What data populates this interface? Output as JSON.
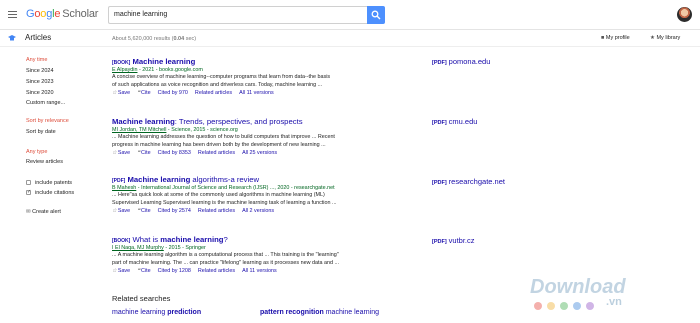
{
  "app": {
    "logo_google": "Google",
    "logo_scholar": "Scholar",
    "search_value": "machine learning",
    "section_title": "Articles",
    "results_count_prefix": "About 5,620,000 results (",
    "results_count_time": "0.04",
    "results_count_suffix": " sec)",
    "my_profile": "My profile",
    "my_library": "My library"
  },
  "sidebar": {
    "time": [
      "Any time",
      "Since 2024",
      "Since 2023",
      "Since 2020",
      "Custom range..."
    ],
    "sort": [
      "Sort by relevance",
      "Sort by date"
    ],
    "type": [
      "Any type",
      "Review articles"
    ],
    "checks": [
      "include patents",
      "include citations"
    ],
    "alert": "Create alert"
  },
  "results": [
    {
      "tag": "[BOOK]",
      "title_pre": "",
      "title_b": "Machine learning",
      "title_post": "",
      "author_link": "E Alpaydin",
      "author_rest": " - 2021 - books.google.com",
      "snip1": "A concise overview of machine learning--computer programs that learn from data--the basis",
      "snip2": "of such applications as voice recognition and driverless cars. Today, machine learning ...",
      "save": "Save",
      "cite": "Cite",
      "cited": "Cited by 970",
      "related": "Related articles",
      "versions": "All 11 versions",
      "pdf_tag": "[PDF]",
      "pdf_src": "pomona.edu"
    },
    {
      "tag": "",
      "title_pre": "",
      "title_b": "Machine learning",
      "title_post": ": Trends, perspectives, and prospects",
      "author_link": "MI Jordan, TM Mitchell",
      "author_rest": " - Science, 2015 - science.org",
      "snip1": "... Machine learning addresses the question of how to build computers that improve ... Recent",
      "snip2": "progress in machine learning has been driven both by the development of new learning ...",
      "save": "Save",
      "cite": "Cite",
      "cited": "Cited by 8353",
      "related": "Related articles",
      "versions": "All 25 versions",
      "pdf_tag": "[PDF]",
      "pdf_src": "cmu.edu"
    },
    {
      "tag": "[PDF]",
      "title_pre": "",
      "title_b": "Machine learning",
      "title_post": " algorithms-a review",
      "author_link": "B Mahesh",
      "author_rest": " - International Journal of Science and Research (IJSR) ..., 2020 - researchgate.net",
      "snip1": "... Here\"sa quick look at some of the commonly used algorithms in machine learning (ML)",
      "snip2": "Supervised Learning Supervised learning is the machine learning task of learning a function ...",
      "save": "Save",
      "cite": "Cite",
      "cited": "Cited by 2574",
      "related": "Related articles",
      "versions": "All 2 versions",
      "pdf_tag": "[PDF]",
      "pdf_src": "researchgate.net"
    },
    {
      "tag": "[BOOK]",
      "title_pre": "What is ",
      "title_b": "machine learning",
      "title_post": "?",
      "author_link": "I El Naqa, MJ Murphy",
      "author_rest": " - 2015 - Springer",
      "snip1": "... A machine learning algorithm is a computational process that ... This training is the \"learning\"",
      "snip2": "part of machine learning. The ... can practice \"lifelong\" learning as it processes new data and ...",
      "save": "Save",
      "cite": "Cite",
      "cited": "Cited by 1208",
      "related": "Related articles",
      "versions": "All 11 versions",
      "pdf_tag": "[PDF]",
      "pdf_src": "vutbr.cz"
    }
  ],
  "related": {
    "heading": "Related searches",
    "items": [
      {
        "a": "machine learning ",
        "b": "prediction"
      },
      {
        "a": "pattern recognition",
        "b": " machine learning"
      }
    ]
  },
  "watermark": {
    "text": "Download",
    "suffix": ".vn"
  },
  "colors": {
    "link": "#1a0dab",
    "red": "#dd4b39",
    "green": "#006621",
    "search_btn": "#4d90fe"
  }
}
